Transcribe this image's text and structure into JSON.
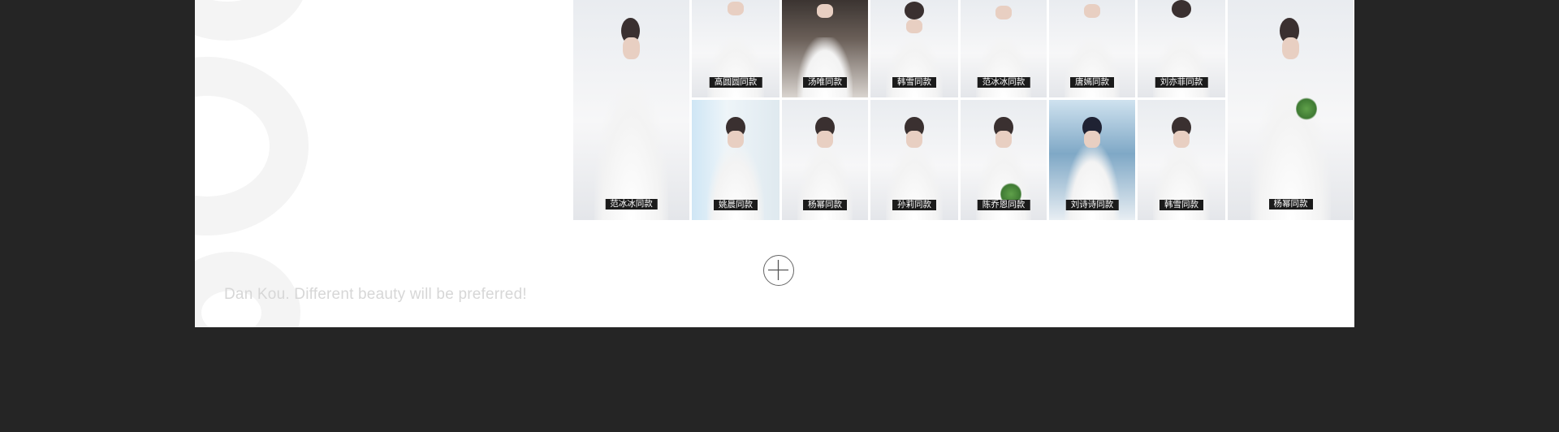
{
  "gallery": {
    "items": [
      {
        "label": "范冰冰同款",
        "style": "light"
      },
      {
        "label": "高圆圆同款",
        "style": "light"
      },
      {
        "label": "汤唯同款",
        "style": "dark"
      },
      {
        "label": "韩雪同款",
        "style": "light"
      },
      {
        "label": "范冰冰同款",
        "style": "light"
      },
      {
        "label": "唐嫣同款",
        "style": "light"
      },
      {
        "label": "刘亦菲同款",
        "style": "light"
      },
      {
        "label": "杨幂同款",
        "style": "light"
      },
      {
        "label": "姚晨同款",
        "style": "window"
      },
      {
        "label": "杨幂同款",
        "style": "light"
      },
      {
        "label": "孙莉同款",
        "style": "light"
      },
      {
        "label": "陈乔恩同款",
        "style": "light"
      },
      {
        "label": "刘诗诗同款",
        "style": "sea"
      },
      {
        "label": "韩雪同款",
        "style": "light"
      }
    ]
  },
  "more_button": {
    "icon": "plus-circle-icon"
  },
  "footer": {
    "tagline": "Dan Kou. Different beauty will be preferred!"
  },
  "colors": {
    "page_bg": "#252525",
    "panel_bg": "#ffffff",
    "label_bg": "#1b1b1b",
    "tagline": "#d7d7d7"
  }
}
